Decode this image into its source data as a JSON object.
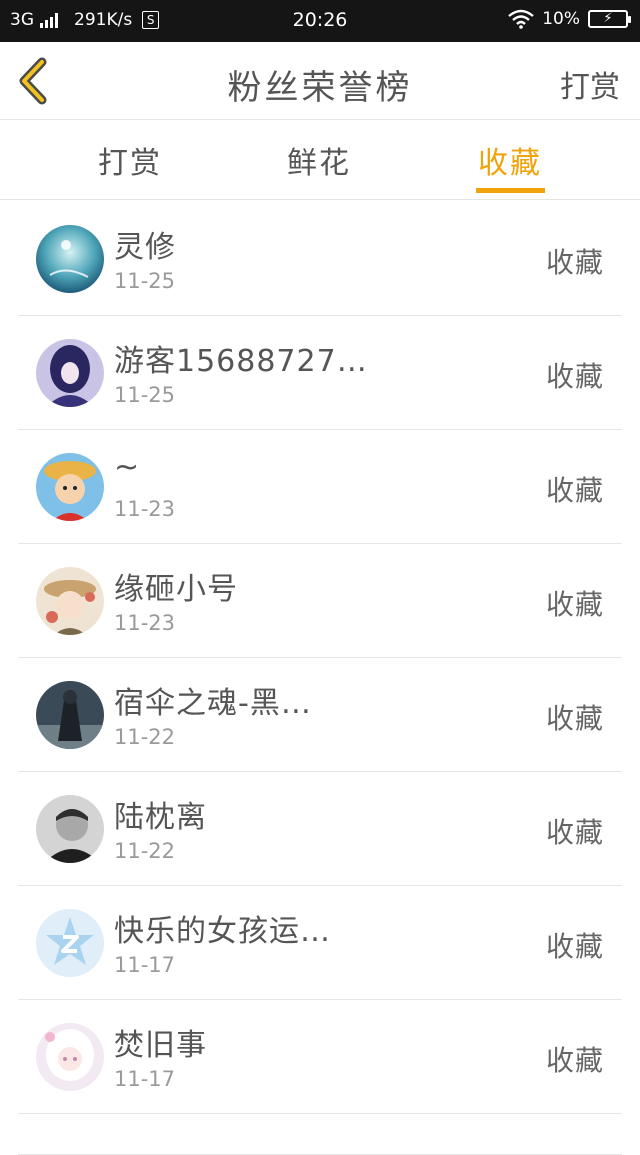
{
  "status_bar": {
    "network": "3G",
    "speed": "291K/s",
    "s_badge": "S",
    "time": "20:26",
    "battery_percent": "10%"
  },
  "header": {
    "title": "粉丝荣誉榜",
    "right_action": "打赏"
  },
  "tabs": [
    {
      "label": "打赏",
      "active": false
    },
    {
      "label": "鲜花",
      "active": false
    },
    {
      "label": "收藏",
      "active": true
    }
  ],
  "items": [
    {
      "name": "灵修",
      "date": "11-25",
      "action": "收藏"
    },
    {
      "name": "游客15688727…",
      "date": "11-25",
      "action": "收藏"
    },
    {
      "name": "~",
      "date": "11-23",
      "action": "收藏"
    },
    {
      "name": "缘砸小号",
      "date": "11-23",
      "action": "收藏"
    },
    {
      "name": "宿伞之魂-黑…",
      "date": "11-22",
      "action": "收藏"
    },
    {
      "name": "陆枕离",
      "date": "11-22",
      "action": "收藏"
    },
    {
      "name": "快乐的女孩运…",
      "date": "11-17",
      "action": "收藏"
    },
    {
      "name": "焚旧事",
      "date": "11-17",
      "action": "收藏"
    }
  ],
  "colors": {
    "accent": "#f0a30a",
    "status_bar_bg": "#151515",
    "text_primary": "#555555",
    "text_secondary": "#9a9a9a"
  }
}
